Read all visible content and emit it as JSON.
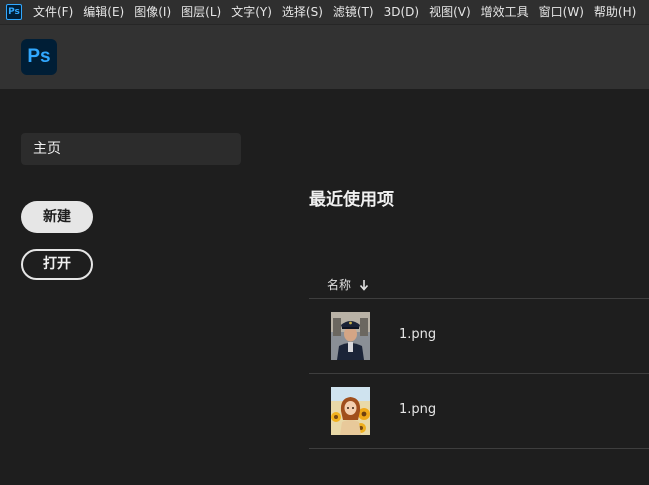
{
  "app": {
    "icon_label": "Ps",
    "logo_label": "Ps"
  },
  "menu": [
    {
      "label": "文件(F)"
    },
    {
      "label": "编辑(E)"
    },
    {
      "label": "图像(I)"
    },
    {
      "label": "图层(L)"
    },
    {
      "label": "文字(Y)"
    },
    {
      "label": "选择(S)"
    },
    {
      "label": "滤镜(T)"
    },
    {
      "label": "3D(D)"
    },
    {
      "label": "视图(V)"
    },
    {
      "label": "增效工具"
    },
    {
      "label": "窗口(W)"
    },
    {
      "label": "帮助(H)"
    }
  ],
  "sidebar": {
    "home_label": "主页"
  },
  "actions": {
    "new_label": "新建",
    "open_label": "打开"
  },
  "recent": {
    "title": "最近使用项",
    "column_name": "名称",
    "files": [
      {
        "name": "1.png",
        "thumbnail": "police-officer-portrait"
      },
      {
        "name": "1.png",
        "thumbnail": "girl-with-sunflowers"
      }
    ]
  },
  "colors": {
    "accent": "#31a8ff",
    "logo_bg": "#001e36"
  }
}
